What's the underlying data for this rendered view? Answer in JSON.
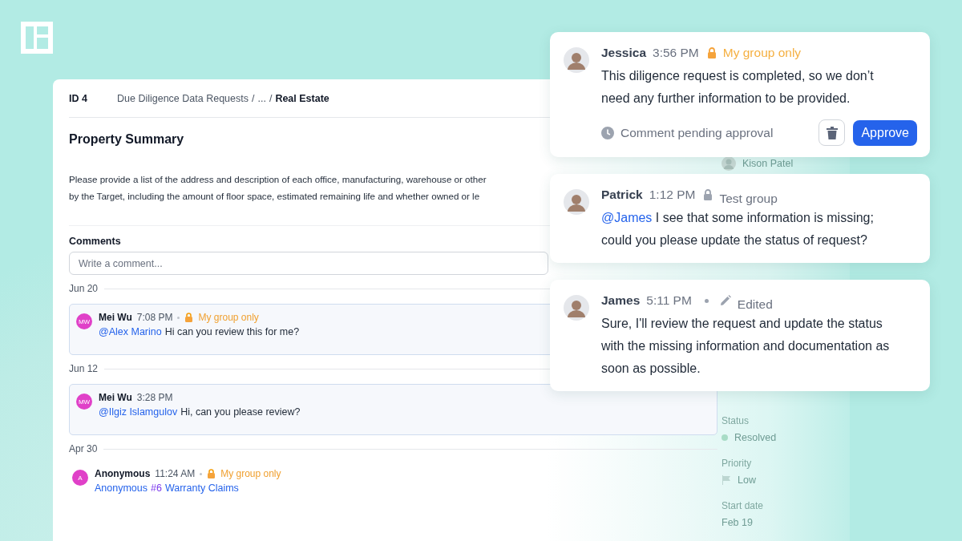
{
  "header": {
    "id": "ID 4",
    "separator": "/",
    "breadcrumb": [
      {
        "text": "Due Diligence Data Requests",
        "current": false
      },
      {
        "text": "...",
        "current": false
      },
      {
        "text": "Real Estate",
        "current": true
      }
    ]
  },
  "title": "Property Summary",
  "description_lines": [
    "Please provide a list of the address and description of each office, manufacturing, warehouse or other",
    "by the Target, including the amount of floor space, estimated remaining life and whether owned or le"
  ],
  "comments": {
    "label": "Comments",
    "placeholder": "Write a comment...",
    "groups": [
      {
        "date": "Jun 20",
        "entries": [
          {
            "initials": "MW",
            "author": "Mei Wu",
            "time": "7:08 PM",
            "visibility": {
              "label": "My group only",
              "kind": "own"
            },
            "boxed": true,
            "body": [
              {
                "kind": "mention",
                "text": "@Alex Marino"
              },
              {
                "kind": "text",
                "text": "Hi can you review this for me?"
              }
            ]
          }
        ]
      },
      {
        "date": "Jun 12",
        "entries": [
          {
            "initials": "MW",
            "author": "Mei Wu",
            "time": "3:28 PM",
            "boxed": true,
            "body": [
              {
                "kind": "mention",
                "text": "@Ilgiz Islamgulov"
              },
              {
                "kind": "text",
                "text": "Hi, can you please review?"
              }
            ]
          }
        ]
      },
      {
        "date": "Apr 30",
        "entries": [
          {
            "initials": "A",
            "author": "Anonymous",
            "time": "11:24 AM",
            "visibility": {
              "label": "My group only",
              "kind": "own"
            },
            "boxed": false,
            "body": [
              {
                "kind": "mention",
                "text": "Anonymous"
              },
              {
                "kind": "tag",
                "text": "#6"
              },
              {
                "kind": "mention",
                "text": "Warranty Claims"
              }
            ]
          }
        ]
      }
    ]
  },
  "sidebar": [
    {
      "kind": "person",
      "text": "Kison Patel"
    },
    {
      "kind": "label",
      "text": "Status"
    },
    {
      "kind": "status",
      "text": "Resolved"
    },
    {
      "kind": "label",
      "text": "Priority"
    },
    {
      "kind": "priority",
      "text": "Low"
    },
    {
      "kind": "label",
      "text": "Start date"
    },
    {
      "kind": "value",
      "text": "Feb 19"
    }
  ],
  "cards": [
    {
      "author": "Jessica",
      "time": "3:56 PM",
      "visibility": {
        "label": "My group only",
        "kind": "own"
      },
      "body": [
        {
          "kind": "text",
          "text": "This diligence request is completed, so we don’t need any further information to be provided."
        }
      ],
      "footer": {
        "status": "Comment pending approval",
        "approve": "Approve"
      }
    },
    {
      "author": "Patrick",
      "time": "1:12 PM",
      "visibility": {
        "label": "Test group",
        "kind": "group"
      },
      "body": [
        {
          "kind": "mention",
          "text": "@James"
        },
        {
          "kind": "text",
          "text": "I see that some information is missing; could you please update the status of request?"
        }
      ]
    },
    {
      "author": "James",
      "time": "5:11 PM",
      "edited": "Edited",
      "body": [
        {
          "kind": "text",
          "text": "Sure, I'll review the request and update the status with the missing information and documentation as soon as possible."
        }
      ]
    }
  ]
}
